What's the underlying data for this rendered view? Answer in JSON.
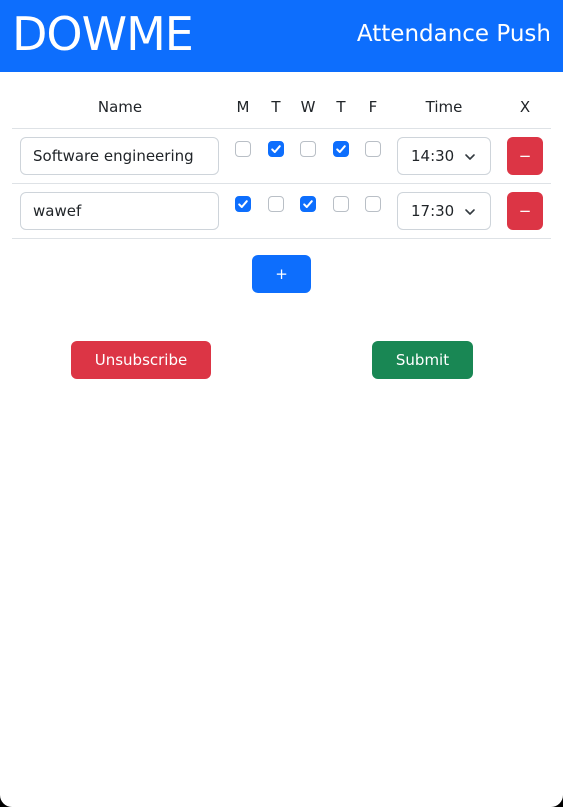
{
  "header": {
    "brand": "DOWME",
    "subtitle": "Attendance Push",
    "color": "#0d6efd"
  },
  "table": {
    "columns": {
      "name": "Name",
      "days": [
        "M",
        "T",
        "W",
        "T",
        "F"
      ],
      "time": "Time",
      "remove": "X"
    },
    "rows": [
      {
        "name": "Software engineering",
        "days": [
          false,
          true,
          false,
          true,
          false
        ],
        "time": "14:30",
        "remove_label": "−"
      },
      {
        "name": "wawef",
        "days": [
          true,
          false,
          true,
          false,
          false
        ],
        "time": "17:30",
        "remove_label": "−"
      }
    ]
  },
  "actions": {
    "add_label": "+",
    "unsubscribe_label": "Unsubscribe",
    "submit_label": "Submit"
  },
  "colors": {
    "primary": "#0d6efd",
    "danger": "#dc3545",
    "success": "#198754"
  },
  "icons": {
    "checkmark": "check-icon",
    "select": "chevron-down-icon"
  }
}
